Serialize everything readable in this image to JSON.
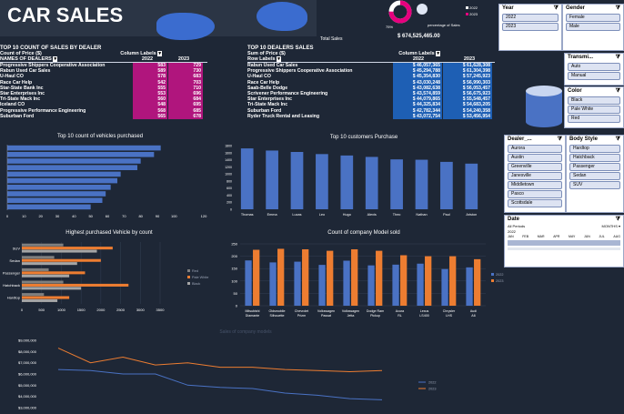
{
  "dashboard": {
    "title": "CAR SALES",
    "total_sales_label": "Total Sales",
    "total_sales_value": "$ 674,525,465.00",
    "donut_pct": "75%",
    "donut_caption": "percentage of Sales",
    "donut_legend": [
      "2022",
      "2023"
    ],
    "donut_share": 0.75
  },
  "table_left": {
    "title": "TOP 10 COUNT OF SALES BY DEALER",
    "subtitle": "Count of Price ($)",
    "col_labels": "Column Labels",
    "row_header": "NAMES OF DEALERS",
    "years": [
      "2022",
      "2023"
    ],
    "rows": [
      {
        "name": "Progressive Shippers Cooperative Association",
        "a": "583",
        "b": "729"
      },
      {
        "name": "Rabun Used Car Sales",
        "a": "589",
        "b": "730"
      },
      {
        "name": "U-Haul CO",
        "a": "578",
        "b": "683"
      },
      {
        "name": "Race Car Help",
        "a": "542",
        "b": "703"
      },
      {
        "name": "Star-State Bank Inc",
        "a": "555",
        "b": "710"
      },
      {
        "name": "Star Enterprises Inc",
        "a": "553",
        "b": "696"
      },
      {
        "name": "Tri-State Mack Inc",
        "a": "560",
        "b": "684"
      },
      {
        "name": "Iceland CO",
        "a": "548",
        "b": "695"
      },
      {
        "name": "Progressive Performance Engineering",
        "a": "568",
        "b": "685"
      },
      {
        "name": "Suburban Ford",
        "a": "565",
        "b": "678"
      }
    ]
  },
  "table_right": {
    "title": "TOP 10 DEALERS SALES",
    "subtitle": "Sum of Price ($)",
    "col_labels": "Column Labels",
    "row_header": "Row Labels",
    "years": [
      "2022",
      "2023"
    ],
    "rows": [
      {
        "name": "Rabun Used Car Sales",
        "a": "$ 46,057,365",
        "b": "$ 61,628,308"
      },
      {
        "name": "Progressive Shippers Cooperative Association",
        "a": "$ 45,294,788",
        "b": "$ 61,304,398"
      },
      {
        "name": "U-Haul CO",
        "a": "$ 45,354,830",
        "b": "$ 57,245,923"
      },
      {
        "name": "Race Car Help",
        "a": "$ 43,030,248",
        "b": "$ 56,990,303"
      },
      {
        "name": "Saab-Belle Dodge",
        "a": "$ 43,082,638",
        "b": "$ 56,053,457"
      },
      {
        "name": "Scrivener Performance Engineering",
        "a": "$ 43,574,859",
        "b": "$ 56,675,923"
      },
      {
        "name": "Star Enterprises Inc",
        "a": "$ 44,079,865",
        "b": "$ 55,548,457"
      },
      {
        "name": "Tri-State Mack Inc",
        "a": "$ 44,325,834",
        "b": "$ 54,683,205"
      },
      {
        "name": "Suburban Ford",
        "a": "$ 42,782,344",
        "b": "$ 54,240,358"
      },
      {
        "name": "Ryder Truck Rental and Leasing",
        "a": "$ 43,072,754",
        "b": "$ 53,456,954"
      }
    ]
  },
  "slicers": {
    "year": {
      "title": "Year",
      "items": [
        "2022",
        "2023"
      ]
    },
    "gender": {
      "title": "Gender",
      "items": [
        "Female",
        "Male"
      ]
    },
    "transmission": {
      "title": "Transmi...",
      "items": [
        "Auto",
        "Manual"
      ]
    },
    "color": {
      "title": "Color",
      "items": [
        "Black",
        "Pale White",
        "Red"
      ]
    },
    "dealer": {
      "title": "Dealer_...",
      "items": [
        "Aurora",
        "Austin",
        "Greenville",
        "Janesville",
        "Middletown",
        "Pasco",
        "Scottsdale"
      ]
    },
    "body": {
      "title": "Body Style",
      "items": [
        "Hardtop",
        "Hatchback",
        "Passenger",
        "Sedan",
        "SUV"
      ]
    }
  },
  "timeline": {
    "title": "Date",
    "subtitle": "All Periods",
    "unit": "MONTHS",
    "year": "2022",
    "months": [
      "JAN",
      "FEB",
      "MAR",
      "APR",
      "MAY",
      "JUN",
      "JUL",
      "AUG"
    ]
  },
  "chart_data": [
    {
      "type": "bar",
      "orientation": "horizontal",
      "title": "Top 10 count of vehicles purchased",
      "categories": [
        "",
        "",
        "",
        "",
        "",
        "",
        "",
        "",
        "",
        ""
      ],
      "values": [
        92,
        88,
        80,
        78,
        68,
        66,
        62,
        59,
        57,
        50
      ],
      "xlim": [
        0,
        120
      ],
      "xticks": [
        "0",
        "10",
        "20",
        "30",
        "40",
        "50",
        "60",
        "70",
        "80",
        "90",
        "100"
      ],
      "color": "#4a72c4"
    },
    {
      "type": "bar",
      "title": "Top 10 customers Purchase",
      "categories": [
        "Thomas",
        "Emma",
        "Lucas",
        "Leo",
        "Hugo",
        "Alexis",
        "Theo",
        "Nathan",
        "Paul",
        "Ariston"
      ],
      "values": [
        1720,
        1660,
        1620,
        1560,
        1520,
        1480,
        1410,
        1400,
        1340,
        1290
      ],
      "ylim": [
        0,
        1800
      ],
      "yticks": [
        "0",
        "200",
        "400",
        "600",
        "800",
        "1000",
        "1200",
        "1400",
        "1600",
        "1800"
      ],
      "color": "#4a72c4"
    },
    {
      "type": "bar",
      "orientation": "horizontal",
      "title": "Highest purchased Vehicle by count",
      "categories": [
        "SUV",
        "Sedan",
        "Passenger",
        "Hatchback",
        "Hardtop"
      ],
      "series": [
        {
          "name": "Red",
          "values": [
            1050,
            820,
            680,
            1050,
            560
          ],
          "color": "#7f7f7f"
        },
        {
          "name": "Pale White",
          "values": [
            2300,
            2000,
            1600,
            2700,
            1200
          ],
          "color": "#ed7d31"
        },
        {
          "name": "Black",
          "values": [
            1900,
            1400,
            1200,
            1500,
            900
          ],
          "color": "#a5a5a5"
        }
      ],
      "xlim": [
        0,
        3500
      ],
      "xticks": [
        "0",
        "500",
        "1000",
        "1500",
        "2000",
        "2500",
        "3000",
        "3500"
      ]
    },
    {
      "type": "bar",
      "title": "Count of  company Model sold",
      "categories": [
        "Mitsubishi Diamante",
        "Oldsmobile Silhouette",
        "Chevrolet Prizm",
        "Volkswagen Passat",
        "Volkswagen Jetta",
        "Dodge Ram Pickup",
        "Acura RL",
        "Lexus LS400",
        "Chrysler LHS",
        "Audi A6"
      ],
      "series": [
        {
          "name": "2022",
          "values": [
            183,
            175,
            178,
            165,
            182,
            163,
            166,
            170,
            148,
            155
          ],
          "color": "#4a72c4"
        },
        {
          "name": "2023",
          "values": [
            226,
            230,
            228,
            222,
            228,
            222,
            204,
            200,
            200,
            188
          ],
          "color": "#ed7d31"
        }
      ],
      "ylim": [
        0,
        250
      ],
      "yticks": [
        "0",
        "50",
        "100",
        "150",
        "200",
        "250"
      ]
    },
    {
      "type": "line",
      "title": "Sales of company models",
      "categories": [
        "",
        "",
        "",
        "",
        "",
        "",
        "",
        "",
        "",
        "",
        ""
      ],
      "series": [
        {
          "name": "2022",
          "values": [
            6400000,
            6300000,
            6000000,
            6000000,
            5000000,
            4800000,
            4700000,
            4300000,
            4100000,
            3800000,
            3700000
          ],
          "color": "#4a72c4"
        },
        {
          "name": "2023",
          "values": [
            8300000,
            7000000,
            7500000,
            6800000,
            7000000,
            6600000,
            6600000,
            6400000,
            6300000,
            6200000,
            6300000
          ],
          "color": "#ed7d31"
        }
      ],
      "ylim": [
        3000000,
        9000000
      ],
      "yticks": [
        "$3,000,000",
        "$4,000,000",
        "$5,000,000",
        "$6,000,000",
        "$7,000,000",
        "$8,000,000",
        "$9,000,000"
      ]
    }
  ]
}
